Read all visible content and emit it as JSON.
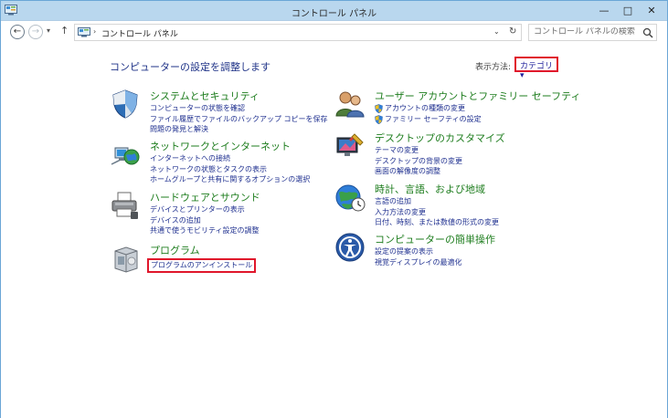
{
  "window": {
    "title": "コントロール パネル",
    "minimize": "—",
    "maximize": "□",
    "close": "✕"
  },
  "nav": {
    "back": "←",
    "forward": "→",
    "recent": "▾",
    "up": "↑",
    "breadcrumb_sep": "›",
    "breadcrumb": "コントロール パネル",
    "dropdown": "⌄",
    "refresh": "↻",
    "search_placeholder": "コントロール パネルの検索"
  },
  "content": {
    "title": "コンピューターの設定を調整します",
    "viewby_label": "表示方法:",
    "viewby_value": "カテゴリ ▾"
  },
  "categories_left": [
    {
      "title": "システムとセキュリティ",
      "links": [
        "コンピューターの状態を確認",
        "ファイル履歴でファイルのバックアップ コピーを保存",
        "問題の発見と解決"
      ]
    },
    {
      "title": "ネットワークとインターネット",
      "links": [
        "インターネットへの接続",
        "ネットワークの状態とタスクの表示",
        "ホームグループと共有に関するオプションの選択"
      ]
    },
    {
      "title": "ハードウェアとサウンド",
      "links": [
        "デバイスとプリンターの表示",
        "デバイスの追加",
        "共通で使うモビリティ設定の調整"
      ]
    },
    {
      "title": "プログラム",
      "links": [
        "プログラムのアンインストール"
      ]
    }
  ],
  "categories_right": [
    {
      "title": "ユーザー アカウントとファミリー セーフティ",
      "links": [
        "アカウントの種類の変更",
        "ファミリー セーフティの設定"
      ]
    },
    {
      "title": "デスクトップのカスタマイズ",
      "links": [
        "テーマの変更",
        "デスクトップの背景の変更",
        "画面の解像度の調整"
      ]
    },
    {
      "title": "時計、言語、および地域",
      "links": [
        "言語の追加",
        "入力方法の変更",
        "日付、時刻、または数値の形式の変更"
      ]
    },
    {
      "title": "コンピューターの簡単操作",
      "links": [
        "設定の提案の表示",
        "視覚ディスプレイの最適化"
      ]
    }
  ]
}
